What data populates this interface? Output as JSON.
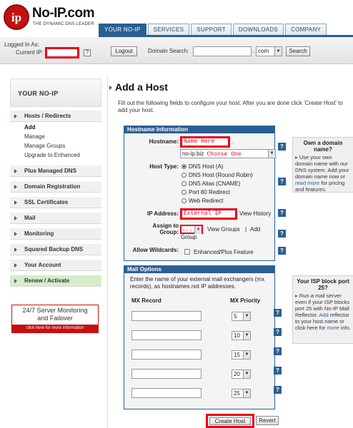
{
  "brand": {
    "name": "No-IP.com",
    "logo_letters": "ip",
    "tagline": "THE DYNAMIC DNS LEADER"
  },
  "nav": {
    "tabs": [
      "YOUR NO-IP",
      "SERVICES",
      "SUPPORT",
      "DOWNLOADS",
      "COMPANY"
    ],
    "active": "YOUR NO-IP"
  },
  "infobar": {
    "logged_in_label": "Logged In As:",
    "current_ip_label": "Current IP:",
    "help": "?",
    "logout": "Logout",
    "domain_search_label": "Domain Search:",
    "domain_search_value": "",
    "dot": ".",
    "tld": "com",
    "search": "Search"
  },
  "sidebar": {
    "title": "YOUR NO-IP",
    "hosts_redirects": "Hosts / Redirects",
    "sub": [
      "Add",
      "Manage",
      "Manage Groups",
      "Upgrade to Enhanced"
    ],
    "items": [
      "Plus Managed DNS",
      "Domain Registration",
      "SSL Certificates",
      "Mail",
      "Monitoring",
      "Squared Backup DNS",
      "Your Account",
      "Renew / Activate"
    ],
    "promo": {
      "line1": "24/7 Server Monitoring",
      "line2": "and Failover",
      "cta": "click here for more information"
    }
  },
  "main": {
    "title": "Add a Host",
    "intro": "Fill out the following fields to configure your host. After you are done click 'Create Host' to add your host.",
    "hostname_panel": {
      "header": "Hostname Information",
      "hostname_label": "Hostname:",
      "hostname_value": "Name Here",
      "hostname_dot": ".",
      "domain_prefix": "no-ip.biz",
      "domain_value": "Choose One",
      "host_type_label": "Host Type:",
      "host_types": [
        "DNS Host (A)",
        "DNS Host (Round Robin)",
        "DNS Alias (CNAME)",
        "Port 80 Redirect",
        "Web Redirect"
      ],
      "ip_label": "IP Address:",
      "ip_value": "External IP",
      "view_history": "View History",
      "group_label_1": "Assign to",
      "group_label_2": "Group:",
      "group_value": "- - -",
      "view_groups": "View Groups",
      "sep": "|",
      "add": "Add",
      "group": "Group",
      "wildcards_label": "Allow Wildcards:",
      "wildcards_text": "Enhanced/Plus Feature"
    },
    "own_domain": {
      "title": "Own a domain name?",
      "body": "Use your own domain name with our DNS system. Add your domain name now or",
      "read_more": "read more",
      "tail": "for pricing and features."
    },
    "mail_panel": {
      "header": "Mail Options",
      "intro": "Enter the name of your external mail exchangers (mx records), as hostnames not IP addresses.",
      "mx_record_label": "MX Record",
      "mx_priority_label": "MX Priority",
      "rows": [
        {
          "record": "",
          "priority": "5"
        },
        {
          "record": "",
          "priority": "10"
        },
        {
          "record": "",
          "priority": "15"
        },
        {
          "record": "",
          "priority": "20"
        },
        {
          "record": "",
          "priority": "25"
        }
      ]
    },
    "isp_block": {
      "title": "Your ISP block port 25?",
      "body": "Run a mail server even if your ISP blocks port 25 with No-IP Mail Reflector.",
      "add": "Add",
      "body2": "reflector to your host name or click here for",
      "more": "more",
      "info": "info."
    },
    "buttons": {
      "create": "Create Host",
      "revert": "Revert"
    }
  },
  "colors": {
    "brand_red": "#c41111",
    "nav_blue": "#2b5f93",
    "highlight_red": "#e8001c",
    "renew_green": "#d7ecc8"
  }
}
